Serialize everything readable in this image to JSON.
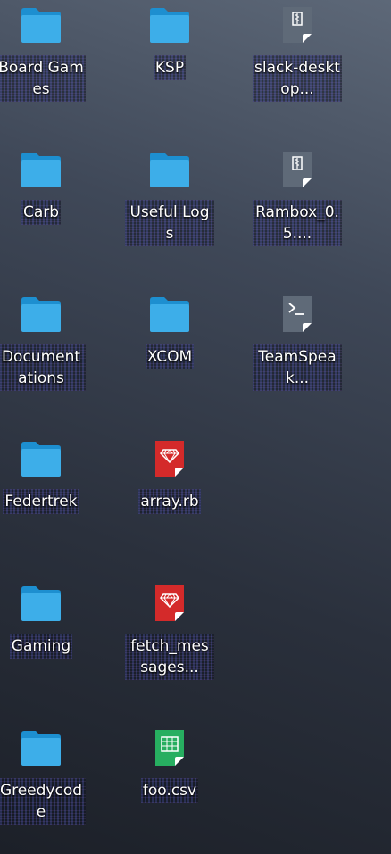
{
  "desktop": {
    "colors": {
      "folder": "#3daee9",
      "folder_tab": "#1d8fd0",
      "archive": "#5f6a78",
      "ruby": "#d42a2a",
      "csv": "#27ae60"
    },
    "items": [
      {
        "label": "Board Games",
        "icon": "folder-icon"
      },
      {
        "label": "KSP",
        "icon": "folder-icon"
      },
      {
        "label": "slack-desktop...",
        "icon": "archive-icon"
      },
      {
        "label": "Carb",
        "icon": "folder-icon"
      },
      {
        "label": "Useful Logs",
        "icon": "folder-icon"
      },
      {
        "label": "Rambox_0.5....",
        "icon": "archive-icon"
      },
      {
        "label": "Documentations",
        "icon": "folder-icon"
      },
      {
        "label": "XCOM",
        "icon": "folder-icon"
      },
      {
        "label": "TeamSpeak...",
        "icon": "terminal-script-icon"
      },
      {
        "label": "Federtrek",
        "icon": "folder-icon"
      },
      {
        "label": "array.rb",
        "icon": "ruby-file-icon"
      },
      {
        "label": "Gaming",
        "icon": "folder-icon"
      },
      {
        "label": "fetch_messages...",
        "icon": "ruby-file-icon"
      },
      {
        "label": "Greedycode",
        "icon": "folder-icon"
      },
      {
        "label": "foo.csv",
        "icon": "spreadsheet-icon"
      }
    ]
  }
}
